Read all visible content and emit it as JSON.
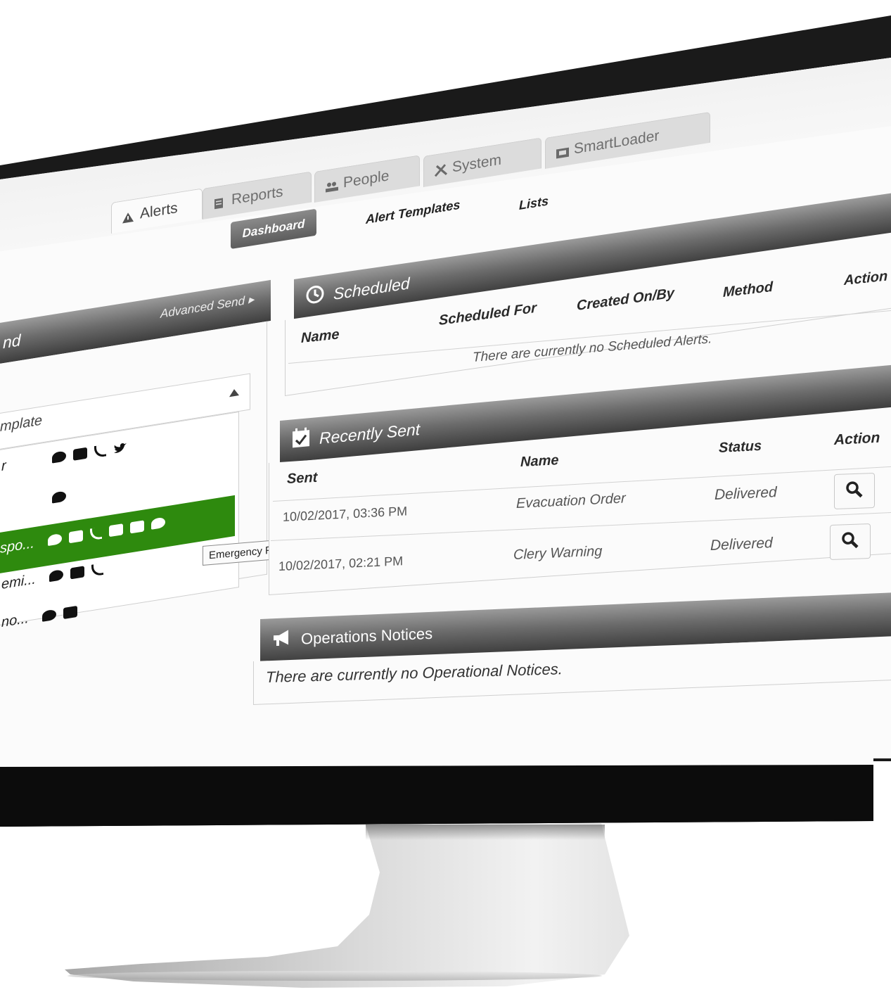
{
  "tabs": [
    {
      "label": "Alerts",
      "icon": "warning-icon",
      "active": true
    },
    {
      "label": "Reports",
      "icon": "report-icon",
      "active": false
    },
    {
      "label": "People",
      "icon": "people-icon",
      "active": false
    },
    {
      "label": "System",
      "icon": "tools-icon",
      "active": false
    },
    {
      "label": "SmartLoader",
      "icon": "smartloader-icon",
      "active": false
    }
  ],
  "subnav": {
    "dashboard": "Dashboard",
    "alert_templates": "Alert Templates",
    "lists": "Lists"
  },
  "quick_send": {
    "title_fragment": "nd",
    "advanced_send": "Advanced Send ▸",
    "select_placeholder": "mplate",
    "items": [
      {
        "label": "r",
        "channels": [
          "chat",
          "email",
          "rss",
          "twitter"
        ]
      },
      {
        "label": "",
        "channels": [
          "desktop"
        ]
      },
      {
        "label": "spo...",
        "channels": [
          "chat",
          "email",
          "rss",
          "twitter",
          "facebook",
          "desktop"
        ],
        "selected": true
      },
      {
        "label": "emi...",
        "channels": [
          "chat",
          "email",
          "phone"
        ]
      },
      {
        "label": "no...",
        "channels": [
          "chat",
          "email"
        ]
      }
    ],
    "tooltip": "Emergency Response Team Alert"
  },
  "scheduled": {
    "title": "Scheduled",
    "columns": [
      "Name",
      "Scheduled For",
      "Created On/By",
      "Method",
      "Action"
    ],
    "empty": "There are currently no Scheduled Alerts."
  },
  "recently_sent": {
    "title": "Recently Sent",
    "columns": [
      "Sent",
      "Name",
      "Status",
      "Action"
    ],
    "rows": [
      {
        "sent": "10/02/2017, 03:36 PM",
        "name": "Evacuation Order",
        "status": "Delivered"
      },
      {
        "sent": "10/02/2017, 02:21 PM",
        "name": "Clery Warning",
        "status": "Delivered"
      }
    ]
  },
  "operations": {
    "title": "Operations Notices",
    "empty": "There are currently no Operational Notices."
  },
  "colors": {
    "selected_row": "#2e8a0e",
    "header_dark": "#3e3e3e"
  }
}
